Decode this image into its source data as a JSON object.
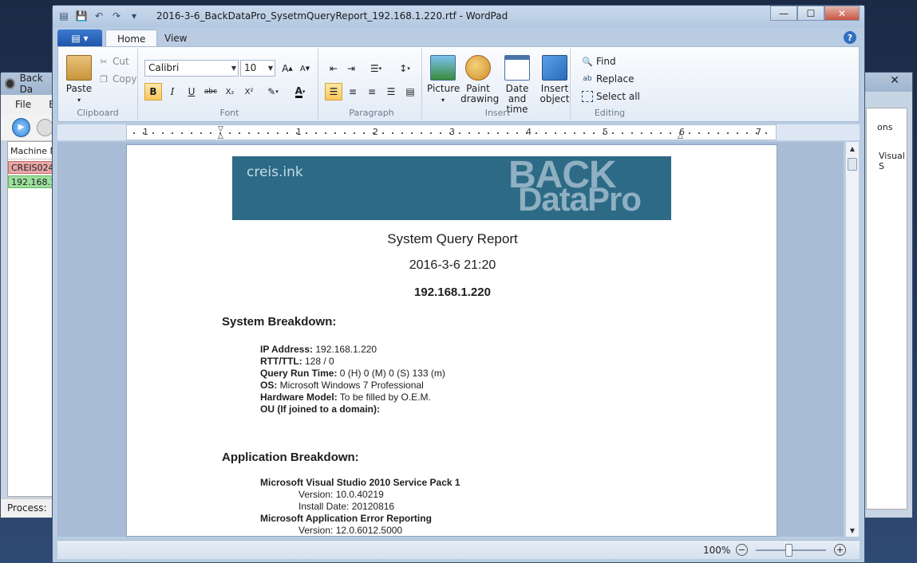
{
  "bg_window": {
    "title": "Back Da",
    "menu": [
      "File",
      "E"
    ],
    "column_header": "Machine N",
    "rows": [
      {
        "label": "CREIS024",
        "status": "red"
      },
      {
        "label": "192.168.1.",
        "status": "green"
      }
    ],
    "status_label": "Process:"
  },
  "bg_window2": {
    "text1": "ons",
    "text2": "Visual S"
  },
  "wordpad": {
    "title": "2016-3-6_BackDataPro_SysetmQueryReport_192.168.1.220.rtf - WordPad",
    "tabs": [
      "Home",
      "View"
    ],
    "clipboard": {
      "paste": "Paste",
      "cut": "Cut",
      "copy": "Copy",
      "group": "Clipboard"
    },
    "font": {
      "family": "Calibri",
      "size": "10",
      "group": "Font",
      "buttons": [
        "B",
        "I",
        "U",
        "abc",
        "X₂",
        "X²"
      ]
    },
    "paragraph": {
      "group": "Paragraph"
    },
    "insert": {
      "picture": "Picture",
      "paint": [
        "Paint",
        "drawing"
      ],
      "datetime": [
        "Date and",
        "time"
      ],
      "object": [
        "Insert",
        "object"
      ],
      "group": "Insert"
    },
    "editing": {
      "find": "Find",
      "replace": "Replace",
      "select_all": "Select all",
      "group": "Editing"
    },
    "ruler_numbers": [
      "1",
      "1",
      "2",
      "3",
      "4",
      "5",
      "6",
      "7"
    ],
    "zoom": "100%"
  },
  "document": {
    "banner_left": "creis.ink",
    "banner_right_1": "BACK",
    "banner_right_2": "DataPro",
    "title": "System Query Report",
    "datetime": "2016-3-6 21:20",
    "host": "192.168.1.220",
    "system_heading": "System Breakdown:",
    "system_lines": [
      {
        "key": "IP Address:",
        "value": " 192.168.1.220"
      },
      {
        "key": "RTT/TTL:",
        "value": " 128 / 0"
      },
      {
        "key": "Query Run Time:",
        "value": " 0 (H) 0 (M) 0 (S) 133 (m)"
      },
      {
        "key": "OS:",
        "value": " Microsoft Windows 7 Professional"
      },
      {
        "key": "Hardware Model:",
        "value": " To be filled by O.E.M."
      },
      {
        "key": "OU (If joined to a domain):",
        "value": ""
      }
    ],
    "app_heading": "Application Breakdown:",
    "apps": [
      {
        "name": "Microsoft Visual Studio 2010 Service Pack 1",
        "version": "Version: 10.0.40219",
        "install": "Install Date: 20120816"
      },
      {
        "name": "Microsoft Application Error Reporting",
        "version": "Version: 12.0.6012.5000"
      }
    ]
  }
}
